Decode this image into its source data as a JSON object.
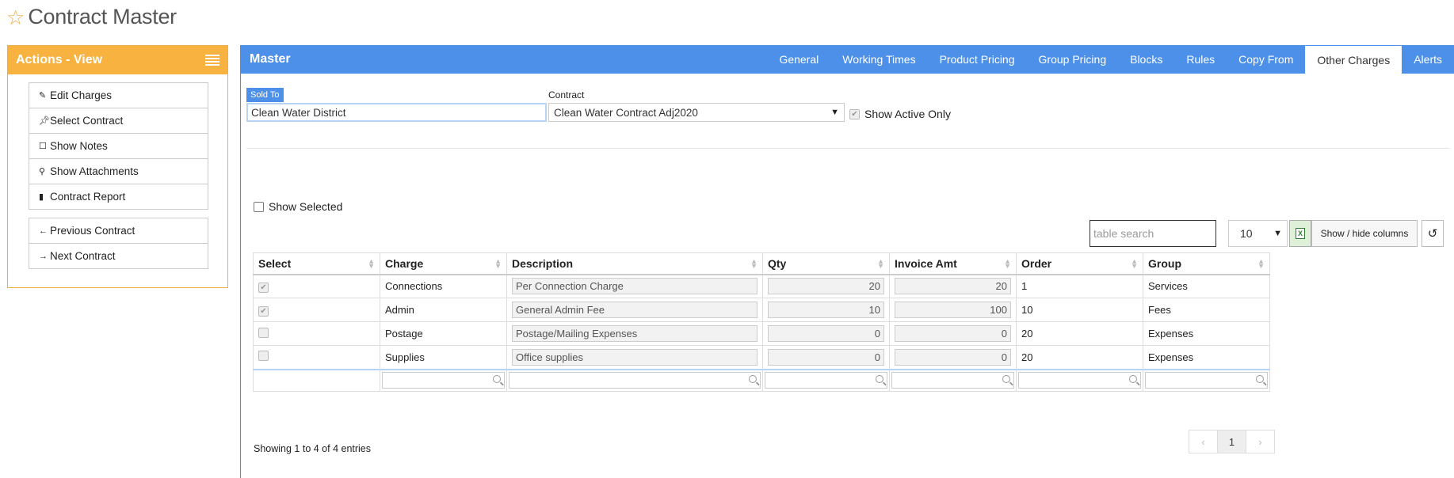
{
  "page": {
    "title": "Contract Master",
    "star_icon": "star-icon"
  },
  "actions": {
    "title": "Actions - View",
    "group1": [
      {
        "label": "Edit Charges",
        "icon": "pencil-icon"
      },
      {
        "label": "Select Contract",
        "icon": "pin-icon"
      },
      {
        "label": "Show Notes",
        "icon": "edit-note-icon"
      },
      {
        "label": "Show Attachments",
        "icon": "paperclip-icon"
      },
      {
        "label": "Contract Report",
        "icon": "file-icon"
      }
    ],
    "group2": [
      {
        "label": "Previous Contract",
        "icon": "arrow-left-icon"
      },
      {
        "label": "Next Contract",
        "icon": "arrow-right-icon"
      }
    ]
  },
  "master": {
    "title": "Master",
    "tabs": [
      "General",
      "Working Times",
      "Product Pricing",
      "Group Pricing",
      "Blocks",
      "Rules",
      "Copy From",
      "Other Charges",
      "Alerts"
    ],
    "active_tab": "Other Charges",
    "accent_color": "#4d90ea"
  },
  "form": {
    "sold_to_label": "Sold To",
    "sold_to_value": "Clean Water District",
    "contract_label": "Contract",
    "contract_value": "Clean Water Contract Adj2020",
    "show_active_only_label": "Show Active Only",
    "show_active_only_checked": true
  },
  "table_controls": {
    "show_selected_label": "Show Selected",
    "search_placeholder": "table search",
    "page_size": "10",
    "show_hide_columns_label": "Show / hide columns"
  },
  "table": {
    "columns": [
      "Select",
      "Charge",
      "Description",
      "Qty",
      "Invoice Amt",
      "Order",
      "Group"
    ],
    "rows": [
      {
        "selected": true,
        "charge": "Connections",
        "description": "Per Connection Charge",
        "qty": "20",
        "invoice_amt": "20",
        "order": "1",
        "group": "Services"
      },
      {
        "selected": true,
        "charge": "Admin",
        "description": "General Admin Fee",
        "qty": "10",
        "invoice_amt": "100",
        "order": "10",
        "group": "Fees"
      },
      {
        "selected": false,
        "charge": "Postage",
        "description": "Postage/Mailing Expenses",
        "qty": "0",
        "invoice_amt": "0",
        "order": "20",
        "group": "Expenses"
      },
      {
        "selected": false,
        "charge": "Supplies",
        "description": "Office supplies",
        "qty": "0",
        "invoice_amt": "0",
        "order": "20",
        "group": "Expenses"
      }
    ]
  },
  "footer": {
    "showing_text": "Showing 1 to 4 of 4 entries",
    "prev": "‹",
    "current_page": "1",
    "next": "›"
  }
}
